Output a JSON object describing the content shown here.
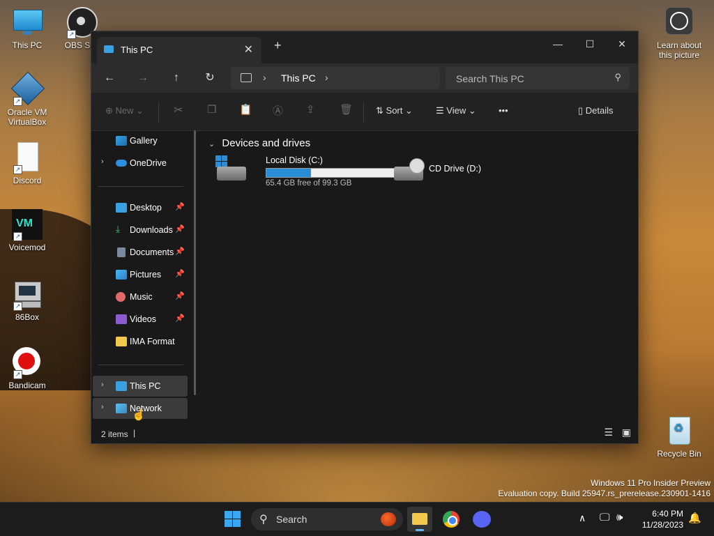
{
  "desktop": {
    "icons": [
      {
        "label": "This PC"
      },
      {
        "label": "OBS Stu"
      },
      {
        "label": "Oracle VM VirtualBox"
      },
      {
        "label": "Discord"
      },
      {
        "label": "Voicemod"
      },
      {
        "label": "86Box"
      },
      {
        "label": "Bandicam"
      },
      {
        "label": "Learn about this picture"
      },
      {
        "label": "Recycle Bin"
      }
    ],
    "watermark": {
      "line1": "Windows 11 Pro Insider Preview",
      "line2": "Evaluation copy. Build 25947.rs_prerelease.230901-1416"
    }
  },
  "window": {
    "tab_title": "This PC",
    "tab_close": "✕",
    "new_tab": "+",
    "controls": {
      "minimize": "—",
      "maximize": "☐",
      "close": "✕"
    },
    "nav": {
      "back": "←",
      "forward": "→",
      "up": "↑",
      "refresh": "↻"
    },
    "address": {
      "crumb": "This PC",
      "separator": "›"
    },
    "search_placeholder": "Search This PC",
    "command_bar": {
      "new": "New",
      "sort": "Sort",
      "view": "View",
      "more": "•••",
      "details": "Details"
    },
    "sidebar": {
      "items": [
        {
          "label": "Gallery"
        },
        {
          "label": "OneDrive"
        },
        {
          "label": "Desktop"
        },
        {
          "label": "Downloads"
        },
        {
          "label": "Documents"
        },
        {
          "label": "Pictures"
        },
        {
          "label": "Music"
        },
        {
          "label": "Videos"
        },
        {
          "label": "IMA Format"
        },
        {
          "label": "This PC"
        },
        {
          "label": "Network"
        }
      ]
    },
    "content": {
      "group_title": "Devices and drives",
      "drives": [
        {
          "name": "Local Disk (C:)",
          "free_text": "65.4 GB free of 99.3 GB",
          "used_fraction": 0.34
        },
        {
          "name": "CD Drive (D:)"
        }
      ]
    },
    "status": {
      "items": "2 items"
    }
  },
  "taskbar": {
    "search_placeholder": "Search",
    "time": "6:40 PM",
    "date": "11/28/2023"
  },
  "colors": {
    "accent": "#2b8dd6",
    "window_bg": "#191919",
    "taskbar_bg": "#1c1c1c"
  }
}
